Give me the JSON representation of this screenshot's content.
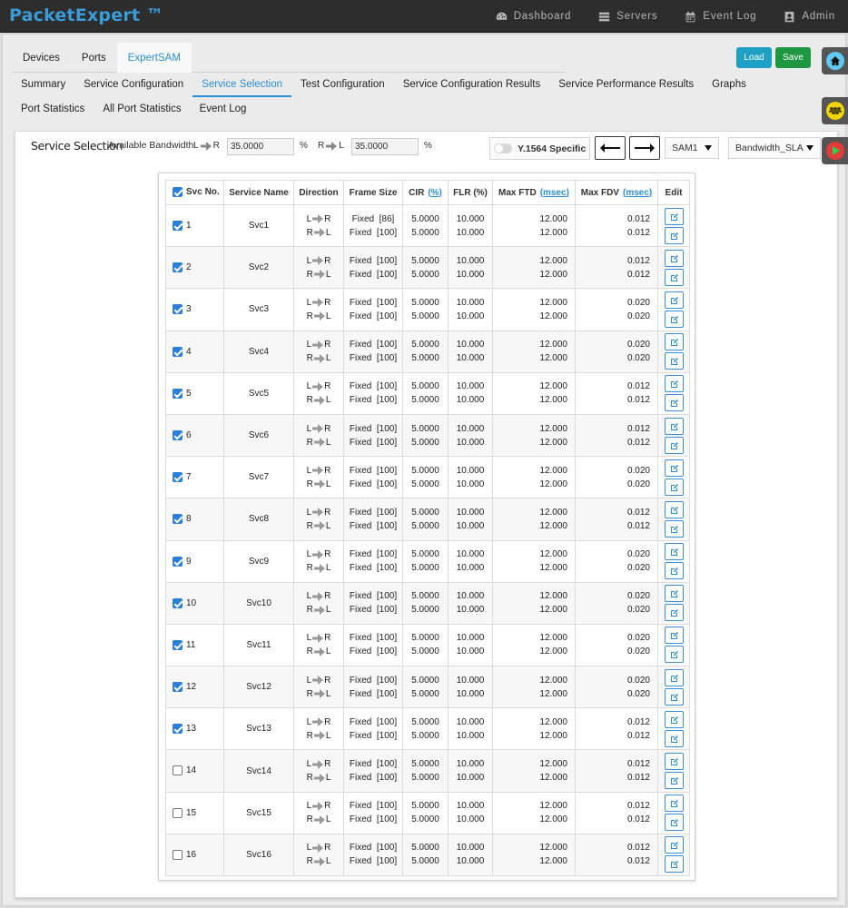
{
  "app": {
    "brand": "PacketExpert ™"
  },
  "topnav": [
    {
      "label": "Dashboard",
      "icon": "dashboard-icon"
    },
    {
      "label": "Servers",
      "icon": "servers-icon"
    },
    {
      "label": "Event Log",
      "icon": "calendar-icon"
    },
    {
      "label": "Admin",
      "icon": "user-icon"
    }
  ],
  "tabs_top": [
    {
      "label": "Devices",
      "active": false
    },
    {
      "label": "Ports",
      "active": false
    },
    {
      "label": "ExpertSAM",
      "active": true
    }
  ],
  "buttons": {
    "load": "Load",
    "save": "Save"
  },
  "tabs_sub": [
    {
      "label": "Summary",
      "active": false
    },
    {
      "label": "Service Configuration",
      "active": false
    },
    {
      "label": "Service Selection",
      "active": true
    },
    {
      "label": "Test Configuration",
      "active": false
    },
    {
      "label": "Service Configuration Results",
      "active": false
    },
    {
      "label": "Service Performance Results",
      "active": false
    },
    {
      "label": "Graphs",
      "active": false
    },
    {
      "label": "Port Statistics",
      "active": false
    },
    {
      "label": "All Port Statistics",
      "active": false
    },
    {
      "label": "Event Log",
      "active": false
    }
  ],
  "selection": {
    "title": "Service Selection",
    "available_bandwidth": "Available Bandwidth",
    "lr_left": "L",
    "lr_right": "R",
    "rl_left": "R",
    "rl_right": "L",
    "lr_value": "35.0000",
    "rl_value": "35.0000",
    "pct": "%",
    "y1564_label": "Y.1564 Specific",
    "y1564_on": false,
    "sam_select": "SAM1",
    "profile_select": "Bandwidth_SLA"
  },
  "table": {
    "headers": {
      "svc_no": "Svc No.",
      "service_name": "Service Name",
      "direction": "Direction",
      "frame_size": "Frame Size",
      "cir": "CIR",
      "cir_unit": "(%)",
      "flr": "FLR (%)",
      "max_ftd": "Max FTD",
      "max_ftd_unit": "(msec)",
      "max_fdv": "Max FDV",
      "max_fdv_unit": "(msec)",
      "edit": "Edit"
    },
    "header_checked": true,
    "dir_lr": [
      "L",
      "R"
    ],
    "dir_rl": [
      "R",
      "L"
    ],
    "rows": [
      {
        "no": "1",
        "checked": true,
        "name": "Svc1",
        "frame1": "Fixed  [86]",
        "frame2": "Fixed  [100]",
        "cir1": "5.0000",
        "cir2": "5.0000",
        "flr1": "10.000",
        "flr2": "10.000",
        "ftd1": "12.000",
        "ftd2": "12.000",
        "fdv1": "0.012",
        "fdv2": "0.012"
      },
      {
        "no": "2",
        "checked": true,
        "name": "Svc2",
        "frame1": "Fixed  [100]",
        "frame2": "Fixed  [100]",
        "cir1": "5.0000",
        "cir2": "5.0000",
        "flr1": "10.000",
        "flr2": "10.000",
        "ftd1": "12.000",
        "ftd2": "12.000",
        "fdv1": "0.012",
        "fdv2": "0.012"
      },
      {
        "no": "3",
        "checked": true,
        "name": "Svc3",
        "frame1": "Fixed  [100]",
        "frame2": "Fixed  [100]",
        "cir1": "5.0000",
        "cir2": "5.0000",
        "flr1": "10.000",
        "flr2": "10.000",
        "ftd1": "12.000",
        "ftd2": "12.000",
        "fdv1": "0.020",
        "fdv2": "0.020"
      },
      {
        "no": "4",
        "checked": true,
        "name": "Svc4",
        "frame1": "Fixed  [100]",
        "frame2": "Fixed  [100]",
        "cir1": "5.0000",
        "cir2": "5.0000",
        "flr1": "10.000",
        "flr2": "10.000",
        "ftd1": "12.000",
        "ftd2": "12.000",
        "fdv1": "0.020",
        "fdv2": "0.020"
      },
      {
        "no": "5",
        "checked": true,
        "name": "Svc5",
        "frame1": "Fixed  [100]",
        "frame2": "Fixed  [100]",
        "cir1": "5.0000",
        "cir2": "5.0000",
        "flr1": "10.000",
        "flr2": "10.000",
        "ftd1": "12.000",
        "ftd2": "12.000",
        "fdv1": "0.012",
        "fdv2": "0.012"
      },
      {
        "no": "6",
        "checked": true,
        "name": "Svc6",
        "frame1": "Fixed  [100]",
        "frame2": "Fixed  [100]",
        "cir1": "5.0000",
        "cir2": "5.0000",
        "flr1": "10.000",
        "flr2": "10.000",
        "ftd1": "12.000",
        "ftd2": "12.000",
        "fdv1": "0.012",
        "fdv2": "0.012"
      },
      {
        "no": "7",
        "checked": true,
        "name": "Svc7",
        "frame1": "Fixed  [100]",
        "frame2": "Fixed  [100]",
        "cir1": "5.0000",
        "cir2": "5.0000",
        "flr1": "10.000",
        "flr2": "10.000",
        "ftd1": "12.000",
        "ftd2": "12.000",
        "fdv1": "0.020",
        "fdv2": "0.020"
      },
      {
        "no": "8",
        "checked": true,
        "name": "Svc8",
        "frame1": "Fixed  [100]",
        "frame2": "Fixed  [100]",
        "cir1": "5.0000",
        "cir2": "5.0000",
        "flr1": "10.000",
        "flr2": "10.000",
        "ftd1": "12.000",
        "ftd2": "12.000",
        "fdv1": "0.012",
        "fdv2": "0.012"
      },
      {
        "no": "9",
        "checked": true,
        "name": "Svc9",
        "frame1": "Fixed  [100]",
        "frame2": "Fixed  [100]",
        "cir1": "5.0000",
        "cir2": "5.0000",
        "flr1": "10.000",
        "flr2": "10.000",
        "ftd1": "12.000",
        "ftd2": "12.000",
        "fdv1": "0.020",
        "fdv2": "0.020"
      },
      {
        "no": "10",
        "checked": true,
        "name": "Svc10",
        "frame1": "Fixed  [100]",
        "frame2": "Fixed  [100]",
        "cir1": "5.0000",
        "cir2": "5.0000",
        "flr1": "10.000",
        "flr2": "10.000",
        "ftd1": "12.000",
        "ftd2": "12.000",
        "fdv1": "0.020",
        "fdv2": "0.020"
      },
      {
        "no": "11",
        "checked": true,
        "name": "Svc11",
        "frame1": "Fixed  [100]",
        "frame2": "Fixed  [100]",
        "cir1": "5.0000",
        "cir2": "5.0000",
        "flr1": "10.000",
        "flr2": "10.000",
        "ftd1": "12.000",
        "ftd2": "12.000",
        "fdv1": "0.020",
        "fdv2": "0.020"
      },
      {
        "no": "12",
        "checked": true,
        "name": "Svc12",
        "frame1": "Fixed  [100]",
        "frame2": "Fixed  [100]",
        "cir1": "5.0000",
        "cir2": "5.0000",
        "flr1": "10.000",
        "flr2": "10.000",
        "ftd1": "12.000",
        "ftd2": "12.000",
        "fdv1": "0.020",
        "fdv2": "0.020"
      },
      {
        "no": "13",
        "checked": true,
        "name": "Svc13",
        "frame1": "Fixed  [100]",
        "frame2": "Fixed  [100]",
        "cir1": "5.0000",
        "cir2": "5.0000",
        "flr1": "10.000",
        "flr2": "10.000",
        "ftd1": "12.000",
        "ftd2": "12.000",
        "fdv1": "0.012",
        "fdv2": "0.012"
      },
      {
        "no": "14",
        "checked": false,
        "name": "Svc14",
        "frame1": "Fixed  [100]",
        "frame2": "Fixed  [100]",
        "cir1": "5.0000",
        "cir2": "5.0000",
        "flr1": "10.000",
        "flr2": "10.000",
        "ftd1": "12.000",
        "ftd2": "12.000",
        "fdv1": "0.012",
        "fdv2": "0.012"
      },
      {
        "no": "15",
        "checked": false,
        "name": "Svc15",
        "frame1": "Fixed  [100]",
        "frame2": "Fixed  [100]",
        "cir1": "5.0000",
        "cir2": "5.0000",
        "flr1": "10.000",
        "flr2": "10.000",
        "ftd1": "12.000",
        "ftd2": "12.000",
        "fdv1": "0.012",
        "fdv2": "0.012"
      },
      {
        "no": "16",
        "checked": false,
        "name": "Svc16",
        "frame1": "Fixed  [100]",
        "frame2": "Fixed  [100]",
        "cir1": "5.0000",
        "cir2": "5.0000",
        "flr1": "10.000",
        "flr2": "10.000",
        "ftd1": "12.000",
        "ftd2": "12.000",
        "fdv1": "0.012",
        "fdv2": "0.012"
      }
    ]
  },
  "side_buttons": [
    {
      "icon": "home-icon",
      "color": "#5ec8f0"
    },
    {
      "icon": "waveform-icon",
      "color": "#f2d400"
    },
    {
      "icon": "play-icon",
      "color": "#e23b3b"
    }
  ],
  "colors": {
    "accent": "#2a8fd6",
    "load": "#21a0c5",
    "save": "#1f9642",
    "topbar": "#2d2d2d"
  }
}
